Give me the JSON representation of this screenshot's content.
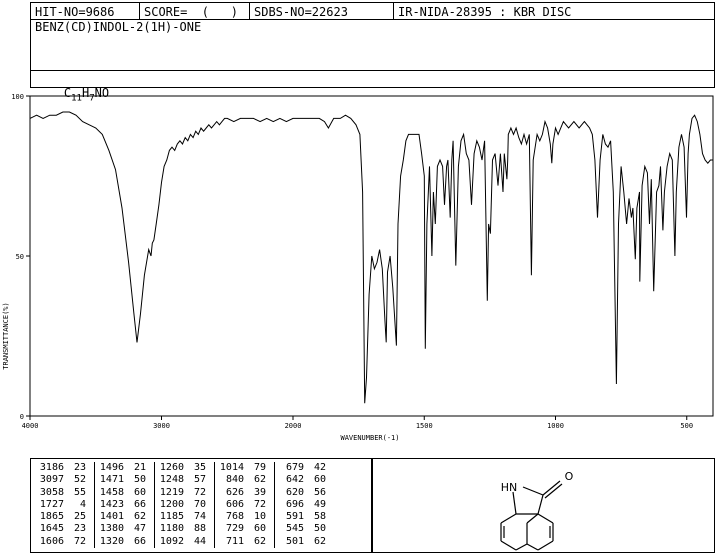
{
  "header": {
    "hit_no": "HIT-NO=9686",
    "score": "SCORE=  (   )",
    "sdbs_no": "SDBS-NO=22623",
    "ir_nida": "IR-NIDA-28395 : KBR DISC",
    "compound_name": "BENZ(CD)INDOL-2(1H)-ONE",
    "formula_c": "C",
    "formula_c_sub": "11",
    "formula_h": "H",
    "formula_h_sub": "7",
    "formula_rest": "NO"
  },
  "chart_data": {
    "type": "line",
    "title": "",
    "xlabel": "WAVENUMBER(-1)",
    "ylabel": "TRANSMITTANCE(%)",
    "xlim": [
      4000,
      400
    ],
    "ylim": [
      0,
      100
    ],
    "x_ticks": [
      "4000",
      "3000",
      "2000",
      "1500",
      "1000",
      "500"
    ],
    "x_tick_values": [
      4000,
      3000,
      2000,
      1500,
      1000,
      500
    ],
    "y_ticks": [
      "0",
      "50",
      "100"
    ],
    "y_tick_values": [
      0,
      50,
      100
    ],
    "series": [
      {
        "points": [
          [
            4000,
            93
          ],
          [
            3950,
            94
          ],
          [
            3900,
            93
          ],
          [
            3850,
            94
          ],
          [
            3800,
            94
          ],
          [
            3750,
            95
          ],
          [
            3700,
            95
          ],
          [
            3650,
            94
          ],
          [
            3600,
            92
          ],
          [
            3550,
            91
          ],
          [
            3500,
            90
          ],
          [
            3450,
            88
          ],
          [
            3400,
            83
          ],
          [
            3350,
            77
          ],
          [
            3300,
            65
          ],
          [
            3250,
            48
          ],
          [
            3210,
            32
          ],
          [
            3186,
            23
          ],
          [
            3160,
            32
          ],
          [
            3130,
            44
          ],
          [
            3097,
            52
          ],
          [
            3080,
            50
          ],
          [
            3070,
            54
          ],
          [
            3058,
            55
          ],
          [
            3040,
            60
          ],
          [
            3020,
            66
          ],
          [
            3000,
            73
          ],
          [
            2980,
            78
          ],
          [
            2960,
            80
          ],
          [
            2940,
            83
          ],
          [
            2920,
            84
          ],
          [
            2900,
            83
          ],
          [
            2880,
            85
          ],
          [
            2860,
            86
          ],
          [
            2840,
            85
          ],
          [
            2820,
            87
          ],
          [
            2800,
            86
          ],
          [
            2780,
            88
          ],
          [
            2760,
            87
          ],
          [
            2740,
            89
          ],
          [
            2720,
            88
          ],
          [
            2700,
            90
          ],
          [
            2680,
            89
          ],
          [
            2660,
            90
          ],
          [
            2640,
            91
          ],
          [
            2620,
            90
          ],
          [
            2600,
            91
          ],
          [
            2580,
            92
          ],
          [
            2560,
            91
          ],
          [
            2540,
            92
          ],
          [
            2520,
            93
          ],
          [
            2500,
            93
          ],
          [
            2450,
            92
          ],
          [
            2400,
            93
          ],
          [
            2350,
            93
          ],
          [
            2300,
            93
          ],
          [
            2250,
            92
          ],
          [
            2200,
            93
          ],
          [
            2150,
            92
          ],
          [
            2100,
            93
          ],
          [
            2050,
            92
          ],
          [
            2000,
            93
          ],
          [
            1950,
            93
          ],
          [
            1900,
            93
          ],
          [
            1880,
            92
          ],
          [
            1865,
            90
          ],
          [
            1845,
            93
          ],
          [
            1820,
            93
          ],
          [
            1800,
            94
          ],
          [
            1780,
            93
          ],
          [
            1760,
            91
          ],
          [
            1745,
            88
          ],
          [
            1735,
            70
          ],
          [
            1727,
            4
          ],
          [
            1720,
            12
          ],
          [
            1710,
            38
          ],
          [
            1700,
            50
          ],
          [
            1690,
            46
          ],
          [
            1680,
            48
          ],
          [
            1670,
            52
          ],
          [
            1660,
            46
          ],
          [
            1650,
            30
          ],
          [
            1645,
            23
          ],
          [
            1640,
            45
          ],
          [
            1630,
            50
          ],
          [
            1620,
            40
          ],
          [
            1606,
            22
          ],
          [
            1600,
            60
          ],
          [
            1590,
            75
          ],
          [
            1580,
            80
          ],
          [
            1570,
            86
          ],
          [
            1560,
            88
          ],
          [
            1540,
            88
          ],
          [
            1520,
            88
          ],
          [
            1510,
            82
          ],
          [
            1500,
            75
          ],
          [
            1496,
            21
          ],
          [
            1490,
            60
          ],
          [
            1480,
            78
          ],
          [
            1471,
            50
          ],
          [
            1465,
            70
          ],
          [
            1458,
            60
          ],
          [
            1450,
            78
          ],
          [
            1440,
            80
          ],
          [
            1430,
            78
          ],
          [
            1423,
            66
          ],
          [
            1415,
            78
          ],
          [
            1410,
            80
          ],
          [
            1401,
            62
          ],
          [
            1395,
            80
          ],
          [
            1390,
            86
          ],
          [
            1380,
            47
          ],
          [
            1370,
            78
          ],
          [
            1360,
            86
          ],
          [
            1350,
            88
          ],
          [
            1340,
            82
          ],
          [
            1330,
            80
          ],
          [
            1320,
            66
          ],
          [
            1310,
            82
          ],
          [
            1300,
            86
          ],
          [
            1290,
            84
          ],
          [
            1280,
            80
          ],
          [
            1270,
            86
          ],
          [
            1260,
            36
          ],
          [
            1255,
            60
          ],
          [
            1248,
            57
          ],
          [
            1240,
            80
          ],
          [
            1230,
            82
          ],
          [
            1219,
            72
          ],
          [
            1210,
            82
          ],
          [
            1200,
            70
          ],
          [
            1195,
            82
          ],
          [
            1185,
            74
          ],
          [
            1182,
            80
          ],
          [
            1180,
            88
          ],
          [
            1170,
            90
          ],
          [
            1160,
            88
          ],
          [
            1150,
            90
          ],
          [
            1140,
            87
          ],
          [
            1130,
            85
          ],
          [
            1120,
            88
          ],
          [
            1110,
            85
          ],
          [
            1100,
            88
          ],
          [
            1092,
            44
          ],
          [
            1085,
            80
          ],
          [
            1070,
            88
          ],
          [
            1060,
            86
          ],
          [
            1050,
            88
          ],
          [
            1040,
            92
          ],
          [
            1030,
            90
          ],
          [
            1020,
            85
          ],
          [
            1014,
            79
          ],
          [
            1010,
            85
          ],
          [
            1000,
            90
          ],
          [
            990,
            88
          ],
          [
            970,
            92
          ],
          [
            950,
            90
          ],
          [
            930,
            92
          ],
          [
            910,
            90
          ],
          [
            890,
            92
          ],
          [
            870,
            90
          ],
          [
            860,
            88
          ],
          [
            850,
            80
          ],
          [
            840,
            62
          ],
          [
            830,
            80
          ],
          [
            820,
            88
          ],
          [
            810,
            85
          ],
          [
            800,
            84
          ],
          [
            790,
            86
          ],
          [
            780,
            70
          ],
          [
            768,
            10
          ],
          [
            760,
            60
          ],
          [
            750,
            78
          ],
          [
            740,
            70
          ],
          [
            729,
            60
          ],
          [
            720,
            68
          ],
          [
            711,
            62
          ],
          [
            705,
            65
          ],
          [
            696,
            49
          ],
          [
            690,
            65
          ],
          [
            680,
            70
          ],
          [
            679,
            42
          ],
          [
            670,
            72
          ],
          [
            660,
            78
          ],
          [
            650,
            76
          ],
          [
            642,
            60
          ],
          [
            635,
            74
          ],
          [
            626,
            39
          ],
          [
            620,
            56
          ],
          [
            615,
            70
          ],
          [
            606,
            72
          ],
          [
            600,
            78
          ],
          [
            591,
            58
          ],
          [
            585,
            70
          ],
          [
            575,
            78
          ],
          [
            565,
            82
          ],
          [
            555,
            80
          ],
          [
            545,
            50
          ],
          [
            540,
            70
          ],
          [
            530,
            84
          ],
          [
            520,
            88
          ],
          [
            510,
            84
          ],
          [
            501,
            62
          ],
          [
            495,
            82
          ],
          [
            490,
            88
          ],
          [
            480,
            93
          ],
          [
            470,
            94
          ],
          [
            460,
            92
          ],
          [
            450,
            88
          ],
          [
            440,
            82
          ],
          [
            430,
            80
          ],
          [
            420,
            79
          ],
          [
            410,
            80
          ],
          [
            400,
            80
          ]
        ]
      }
    ]
  },
  "peak_table": {
    "columns": [
      [
        [
          "3186",
          "23"
        ],
        [
          "3097",
          "52"
        ],
        [
          "3058",
          "55"
        ],
        [
          "1727",
          "4"
        ],
        [
          "1865",
          "25"
        ],
        [
          "1645",
          "23"
        ],
        [
          "1606",
          "72"
        ]
      ],
      [
        [
          "1496",
          "21"
        ],
        [
          "1471",
          "50"
        ],
        [
          "1458",
          "60"
        ],
        [
          "1423",
          "66"
        ],
        [
          "1401",
          "62"
        ],
        [
          "1380",
          "47"
        ],
        [
          "1320",
          "66"
        ]
      ],
      [
        [
          "1260",
          "35"
        ],
        [
          "1248",
          "57"
        ],
        [
          "1219",
          "72"
        ],
        [
          "1200",
          "70"
        ],
        [
          "1185",
          "74"
        ],
        [
          "1180",
          "88"
        ],
        [
          "1092",
          "44"
        ]
      ],
      [
        [
          "1014",
          "79"
        ],
        [
          "840",
          "62"
        ],
        [
          "626",
          "39"
        ],
        [
          "606",
          "72"
        ],
        [
          "768",
          "10"
        ],
        [
          "729",
          "60"
        ],
        [
          "711",
          "62"
        ]
      ],
      [
        [
          "679",
          "42"
        ],
        [
          "642",
          "60"
        ],
        [
          "620",
          "56"
        ],
        [
          "696",
          "49"
        ],
        [
          "591",
          "58"
        ],
        [
          "545",
          "50"
        ],
        [
          "501",
          "62"
        ]
      ]
    ]
  },
  "structure": {
    "nh_label": "HN",
    "o_label": "O"
  }
}
